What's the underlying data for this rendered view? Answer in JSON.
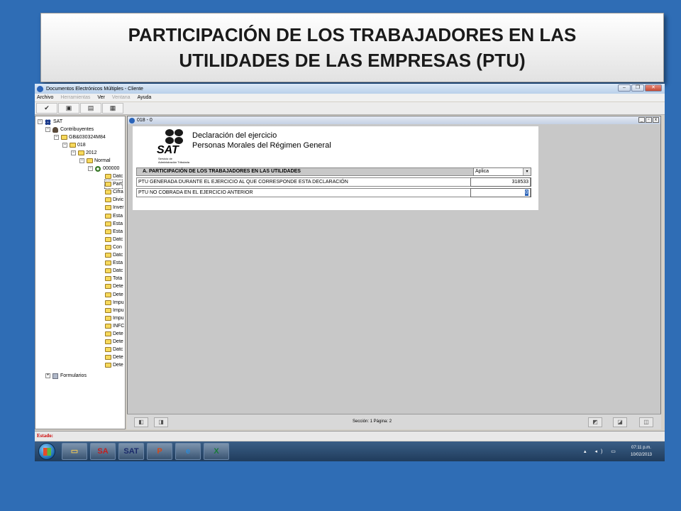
{
  "slide": {
    "title_line1": "PARTICIPACIÓN DE LOS TRABAJADORES EN LAS",
    "title_line2": "UTILIDADES DE LAS EMPRESAS (PTU)"
  },
  "window": {
    "title": "Documentos Electrónicos Múltiples - Cliente",
    "controls": [
      "–",
      "❐",
      "✕"
    ]
  },
  "menu": {
    "items": [
      {
        "label": "Archivo",
        "enabled": true
      },
      {
        "label": "Herramientas",
        "enabled": false
      },
      {
        "label": "Ver",
        "enabled": true
      },
      {
        "label": "Ventana",
        "enabled": false
      },
      {
        "label": "Ayuda",
        "enabled": true
      }
    ]
  },
  "toolbar": {
    "buttons": [
      {
        "icon": "check-icon",
        "glyph": "✔"
      },
      {
        "icon": "print-icon",
        "glyph": "▣"
      },
      {
        "icon": "document-icon",
        "glyph": "▤"
      },
      {
        "icon": "tools-icon",
        "glyph": "▦"
      }
    ]
  },
  "tree": {
    "root": "SAT",
    "contribuyentes": "Contribuyentes",
    "rfc": "GB&030324M84",
    "form": "018",
    "year": "2012",
    "type": "Normal",
    "declaracion": "000000",
    "leaves": [
      "Datc",
      "Part",
      "Cifra",
      "Divic",
      "Inver",
      "Esta",
      "Esta",
      "Esta",
      "Datc",
      "Con",
      "Datc",
      "Esta",
      "Datc",
      "Tota",
      "Dete",
      "Dete",
      "Impu",
      "Impu",
      "Impu",
      "INFC",
      "Dete",
      "Dete",
      "Datc",
      "Dete",
      "Dete"
    ],
    "formularios": "Formularios",
    "scroll_left": "◂",
    "scroll_right": "▸"
  },
  "document": {
    "title": "018 - 0",
    "controls": [
      "_",
      "▫",
      "x"
    ],
    "logo_word": "SAT",
    "logo_sub_line1": "Servicio de",
    "logo_sub_line2": "Administración Tributaria",
    "heading_line1": "Declaración del ejercicio",
    "heading_line2": "Personas Morales del Régimen General",
    "section_title": "A. PARTICIPACIÓN DE LOS TRABAJADORES EN LAS UTILIDADES",
    "section_select": "Aplica",
    "select_arrow": "▾",
    "rows": [
      {
        "label": "PTU GENERADA DURANTE EL EJERCICIO AL QUE CORRESPONDE ESTA DECLARACIÓN",
        "value": "318533"
      },
      {
        "label": "PTU NO COBRADA EN EL EJERCICIO ANTERIOR",
        "value": "0"
      }
    ]
  },
  "nav": {
    "section_label": "Sección: 1  Página: 2",
    "buttons": [
      "◧",
      "◨",
      "◩",
      "◪",
      "◫"
    ]
  },
  "status": {
    "label": "Estado:"
  },
  "taskbar": {
    "apps": [
      {
        "name": "file-explorer-icon",
        "glyph": "▭",
        "color": "#e6c25a"
      },
      {
        "name": "sa-app-icon",
        "glyph": "SA",
        "color": "#c02020"
      },
      {
        "name": "sat-app-icon",
        "glyph": "SAT",
        "color": "#1a2a6a"
      },
      {
        "name": "powerpoint-icon",
        "glyph": "P",
        "color": "#d04a1a"
      },
      {
        "name": "internet-explorer-icon",
        "glyph": "e",
        "color": "#2a8ad8"
      },
      {
        "name": "excel-icon",
        "glyph": "X",
        "color": "#1a7a3a"
      }
    ],
    "tray_icons": "▴ ◂) ▭",
    "time": "07:11 p.m.",
    "date": "10/02/2013"
  }
}
